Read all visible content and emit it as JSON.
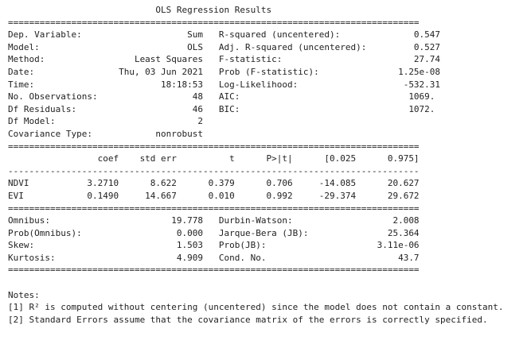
{
  "report": {
    "lines": [
      "                            OLS Regression Results                            ",
      "==============================================================================",
      "Dep. Variable:                    Sum   R-squared (uncentered):              0.547",
      "Model:                            OLS   Adj. R-squared (uncentered):         0.527",
      "Method:                 Least Squares   F-statistic:                         27.74",
      "Date:                Thu, 03 Jun 2021   Prob (F-statistic):               1.25e-08",
      "Time:                        18:18:53   Log-Likelihood:                    -532.31",
      "No. Observations:                  48   AIC:                                1069.",
      "Df Residuals:                      46   BIC:                                1072.",
      "Df Model:                           2                                            ",
      "Covariance Type:            nonrobust                                            ",
      "==============================================================================",
      "                 coef    std err          t      P>|t|      [0.025      0.975]",
      "------------------------------------------------------------------------------",
      "NDVI           3.2710      8.622      0.379      0.706     -14.085      20.627",
      "EVI            0.1490     14.667      0.010      0.992     -29.374      29.672",
      "==============================================================================",
      "Omnibus:                       19.778   Durbin-Watson:                   2.008",
      "Prob(Omnibus):                  0.000   Jarque-Bera (JB):               25.364",
      "Skew:                           1.503   Prob(JB):                     3.11e-06",
      "Kurtosis:                       4.909   Cond. No.                         43.7",
      "==============================================================================",
      "",
      "Notes:",
      "[1] R² is computed without centering (uncentered) since the model does not contain a constant.",
      "[2] Standard Errors assume that the covariance matrix of the errors is correctly specified."
    ]
  }
}
